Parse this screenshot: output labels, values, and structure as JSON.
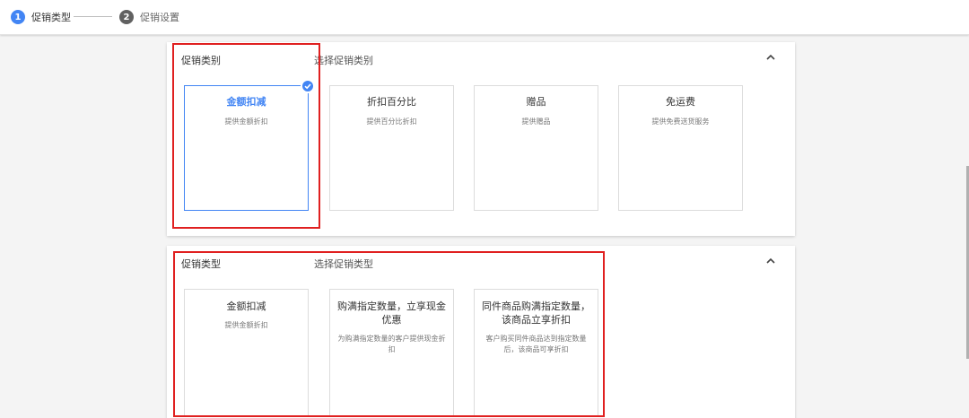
{
  "stepper": {
    "steps": [
      {
        "number": "1",
        "label": "促销类型",
        "active": true
      },
      {
        "number": "2",
        "label": "促销设置",
        "active": false
      }
    ]
  },
  "category_panel": {
    "title": "促销类别",
    "subtitle": "选择促销类别",
    "collapse_icon": "chevron-up-icon",
    "cards": [
      {
        "title": "金额扣减",
        "desc": "提供金额折扣",
        "selected": true
      },
      {
        "title": "折扣百分比",
        "desc": "提供百分比折扣",
        "selected": false
      },
      {
        "title": "赠品",
        "desc": "提供赠品",
        "selected": false
      },
      {
        "title": "免运费",
        "desc": "提供免费送货服务",
        "selected": false
      }
    ]
  },
  "type_panel": {
    "title": "促销类型",
    "subtitle": "选择促销类型",
    "collapse_icon": "chevron-up-icon",
    "cards": [
      {
        "title": "金额扣减",
        "desc": "提供金额折扣"
      },
      {
        "title": "购满指定数量，立享现金优惠",
        "desc": "为购满指定数量的客户提供现金折扣"
      },
      {
        "title": "同件商品购满指定数量，该商品立享折扣",
        "desc": "客户购买同件商品达到指定数量后，该商品可享折扣"
      }
    ]
  },
  "colors": {
    "accent": "#4285f4",
    "highlight_box": "#e02020",
    "inactive_step": "#616161"
  }
}
